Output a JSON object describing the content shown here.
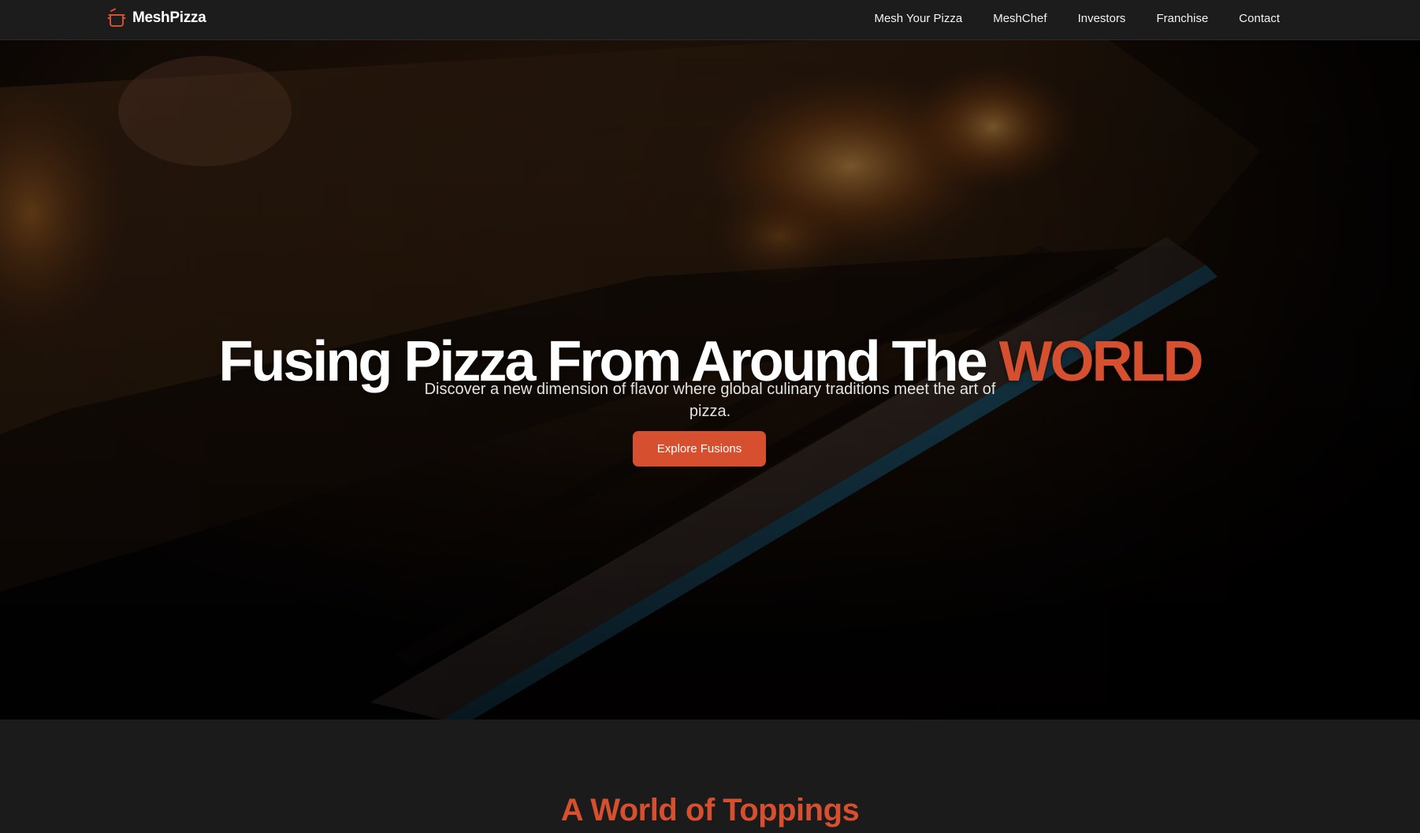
{
  "navbar": {
    "brand": "MeshPizza",
    "links": [
      "Mesh Your Pizza",
      "MeshChef",
      "Investors",
      "Franchise",
      "Contact"
    ]
  },
  "hero": {
    "title_main": "Fusing Pizza From Around The ",
    "title_accent": "WORLD",
    "subtitle": "Discover a new dimension of flavor where global culinary traditions meet the art of pizza.",
    "cta": "Explore Fusions"
  },
  "toppings": {
    "title": "A World of Toppings"
  },
  "colors": {
    "accent": "#d6502f",
    "nav_background": "#1c1c1c",
    "page_background": "#1b1b1b"
  },
  "icons": {
    "brand": "pizza-oven-icon"
  }
}
